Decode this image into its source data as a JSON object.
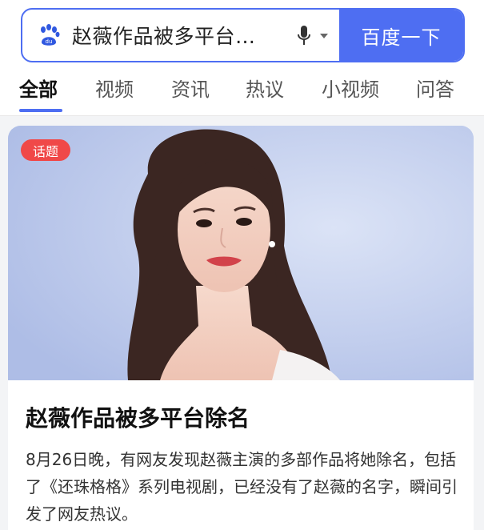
{
  "search": {
    "query": "赵薇作品被多平台…",
    "button_label": "百度一下"
  },
  "tabs": [
    {
      "label": "全部",
      "active": true
    },
    {
      "label": "视频",
      "active": false
    },
    {
      "label": "资讯",
      "active": false
    },
    {
      "label": "热议",
      "active": false
    },
    {
      "label": "小视频",
      "active": false
    },
    {
      "label": "问答",
      "active": false
    }
  ],
  "card": {
    "badge": "话题",
    "title": "赵薇作品被多平台除名",
    "description": "8月26日晚，有网友发现赵薇主演的多部作品将她除名，包括了《还珠格格》系列电视剧，已经没有了赵薇的名字，瞬间引发了网友热议。"
  },
  "icons": {
    "logo": "baidu-paw-icon",
    "voice": "microphone-icon",
    "dropdown": "caret-down-icon"
  },
  "colors": {
    "accent": "#4e6ef2",
    "badge": "#f04848"
  }
}
